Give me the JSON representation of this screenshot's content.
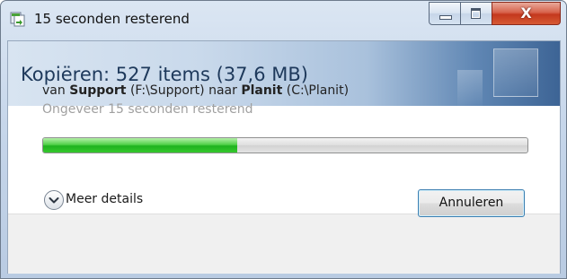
{
  "window": {
    "title": "15 seconden resterend",
    "icon": "file-copy-icon",
    "caption_buttons": [
      "minimize-icon",
      "maximize-icon",
      "close-icon"
    ],
    "close_glyph": "X"
  },
  "header": {
    "title": "Kopiëren: 527 items (37,6 MB)"
  },
  "route": {
    "prefix": "van ",
    "source_name": "Support",
    "source_path": " (F:\\Support) naar ",
    "dest_name": "Planit",
    "dest_path": " (C:\\Planit)"
  },
  "status": {
    "time_remaining": "Ongeveer 15 seconden resterend"
  },
  "progress": {
    "fraction": 0.4
  },
  "footer": {
    "details_label": "Meer details",
    "details_icon": "chevron-down-circle-icon",
    "cancel_label": "Annuleren"
  },
  "colors": {
    "progress_green": "#1fb21e",
    "header_text": "#1e395b",
    "close_red": "#c4381d"
  }
}
